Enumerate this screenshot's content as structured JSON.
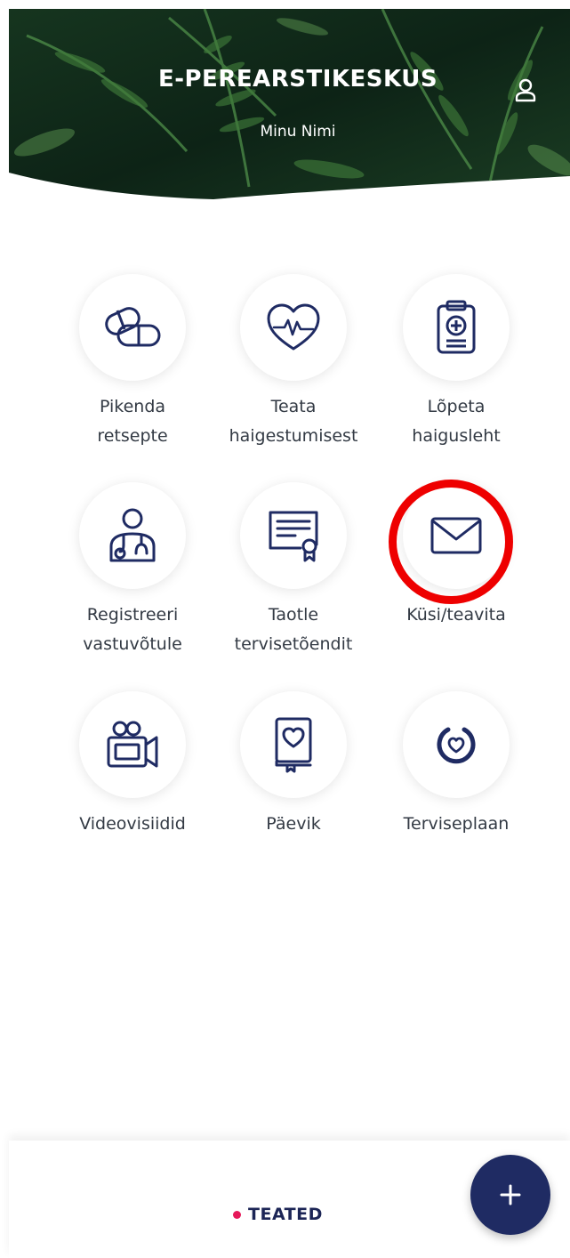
{
  "header": {
    "title": "E-PEREARSTIKESKUS",
    "user_name": "Minu Nimi",
    "profile_icon": "user-icon"
  },
  "menu": {
    "items": [
      {
        "line1": "Pikenda",
        "line2": "retsepte",
        "icon": "pills-icon"
      },
      {
        "line1": "Teata",
        "line2": "haigestumisest",
        "icon": "heartbeat-icon"
      },
      {
        "line1": "Lõpeta",
        "line2": "haigusleht",
        "icon": "medical-clipboard-icon"
      },
      {
        "line1": "Registreeri",
        "line2": "vastuvõtule",
        "icon": "doctor-icon"
      },
      {
        "line1": "Taotle",
        "line2": "tervisetõendit",
        "icon": "certificate-icon"
      },
      {
        "line1": "Küsi/teavita",
        "line2": "",
        "icon": "envelope-icon",
        "highlighted": true
      },
      {
        "line1": "Videovisiidid",
        "line2": "",
        "icon": "video-camera-icon"
      },
      {
        "line1": "Päevik",
        "line2": "",
        "icon": "diary-icon"
      },
      {
        "line1": "Terviseplaan",
        "line2": "",
        "icon": "health-plan-icon"
      }
    ]
  },
  "bottom": {
    "tab_label": "TEATED",
    "fab_symbol": "+"
  },
  "colors": {
    "icon": "#1f2b63",
    "highlight": "#ee0000",
    "badge_dot": "#e6195a",
    "fab": "#1f2b63"
  }
}
